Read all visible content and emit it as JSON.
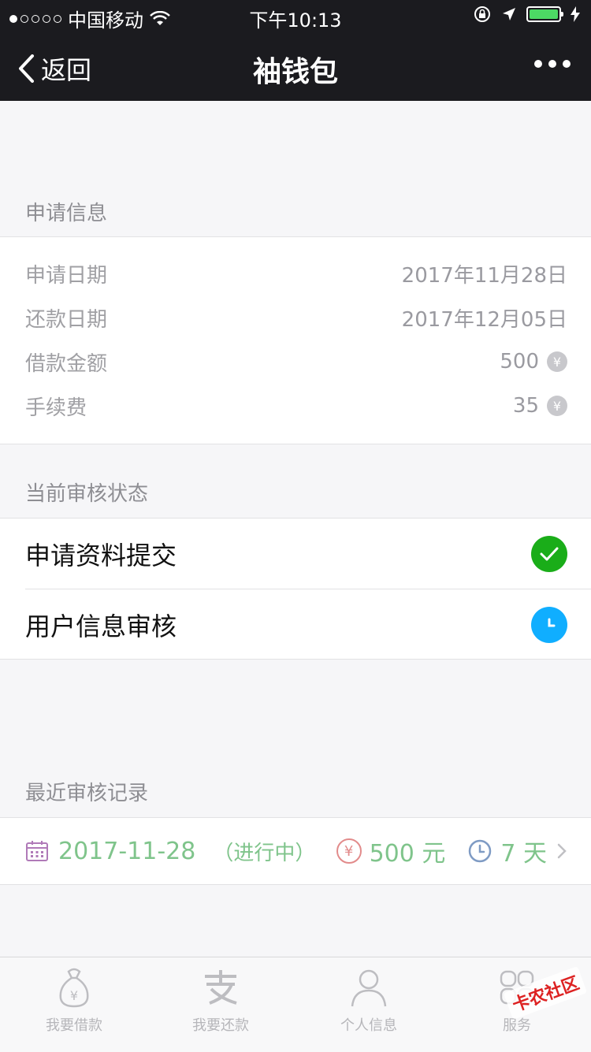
{
  "status_bar": {
    "carrier": "中国移动",
    "time": "下午10:13",
    "battery_level_pct": 100
  },
  "nav": {
    "back_label": "返回",
    "title": "袖钱包"
  },
  "application_info": {
    "header": "申请信息",
    "rows": [
      {
        "label": "申请日期",
        "value": "2017年11月28日"
      },
      {
        "label": "还款日期",
        "value": "2017年12月05日"
      },
      {
        "label": "借款金额",
        "value": "500",
        "currency_symbol": "¥"
      },
      {
        "label": "手续费",
        "value": "35",
        "currency_symbol": "¥"
      }
    ]
  },
  "review_status": {
    "header": "当前审核状态",
    "steps": [
      {
        "label": "申请资料提交",
        "state": "done",
        "icon": "check-icon",
        "color": "#1aad19"
      },
      {
        "label": "用户信息审核",
        "state": "pending",
        "icon": "clock-icon",
        "color": "#10aeff"
      }
    ]
  },
  "recent_records": {
    "header": "最近审核记录",
    "items": [
      {
        "date": "2017-11-28",
        "status": "（进行中）",
        "amount": "500 元",
        "days": "7 天"
      }
    ]
  },
  "tab_bar": {
    "tabs": [
      {
        "label": "我要借款",
        "icon": "money-bag-icon"
      },
      {
        "label": "我要还款",
        "icon": "alipay-icon"
      },
      {
        "label": "个人信息",
        "icon": "person-icon"
      },
      {
        "label": "服务",
        "icon": "grid-icon"
      }
    ]
  },
  "watermark": "卡农社区",
  "colors": {
    "nav_bg": "#1b1b1f",
    "page_bg": "#f6f6f8",
    "record_green": "#7fc48b",
    "done_green": "#1aad19",
    "pending_blue": "#10aeff"
  }
}
